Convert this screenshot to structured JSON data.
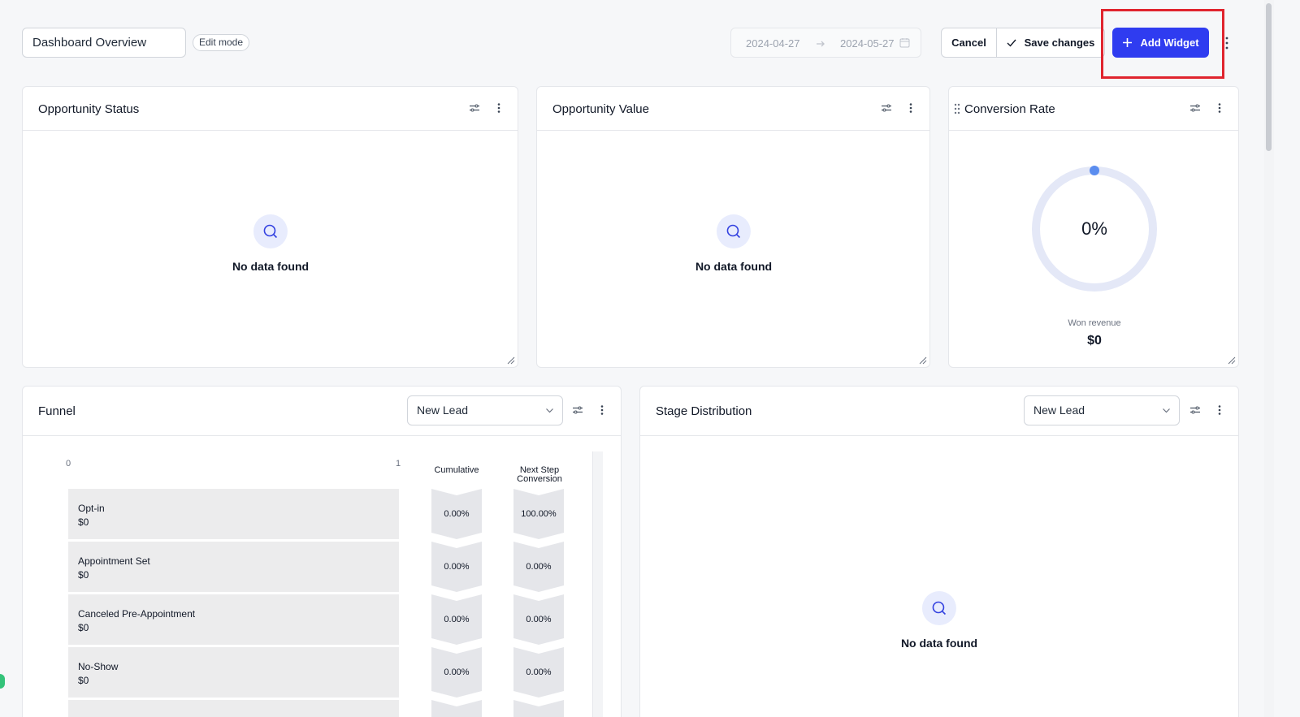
{
  "header": {
    "dashboard_name": "Dashboard Overview",
    "mode_badge": "Edit mode",
    "date_start": "2024-04-27",
    "date_end": "2024-05-27",
    "cancel_label": "Cancel",
    "save_label": "Save changes",
    "add_widget_label": "Add Widget"
  },
  "widgets": {
    "opportunity_status": {
      "title": "Opportunity Status",
      "empty_text": "No data found"
    },
    "opportunity_value": {
      "title": "Opportunity Value",
      "empty_text": "No data found"
    },
    "conversion_rate": {
      "title": "Conversion Rate",
      "value": "0%",
      "won_label": "Won revenue",
      "won_value": "$0"
    },
    "funnel": {
      "title": "Funnel",
      "select_value": "New Lead",
      "axis_min": "0",
      "axis_max": "1",
      "col_cumulative": "Cumulative",
      "col_next_line1": "Next Step",
      "col_next_line2": "Conversion",
      "stages": [
        {
          "name": "Opt-in",
          "value": "$0",
          "cumulative": "0.00%",
          "next": "100.00%"
        },
        {
          "name": "Appointment Set",
          "value": "$0",
          "cumulative": "0.00%",
          "next": "0.00%"
        },
        {
          "name": "Canceled Pre-Appointment",
          "value": "$0",
          "cumulative": "0.00%",
          "next": "0.00%"
        },
        {
          "name": "No-Show",
          "value": "$0",
          "cumulative": "0.00%",
          "next": "0.00%"
        }
      ]
    },
    "stage_distribution": {
      "title": "Stage Distribution",
      "select_value": "New Lead",
      "empty_text": "No data found"
    }
  },
  "colors": {
    "primary": "#2f3cf0",
    "highlight": "#e0242e",
    "ring": "#e4e8f7",
    "ring_dot": "#5b8def"
  }
}
